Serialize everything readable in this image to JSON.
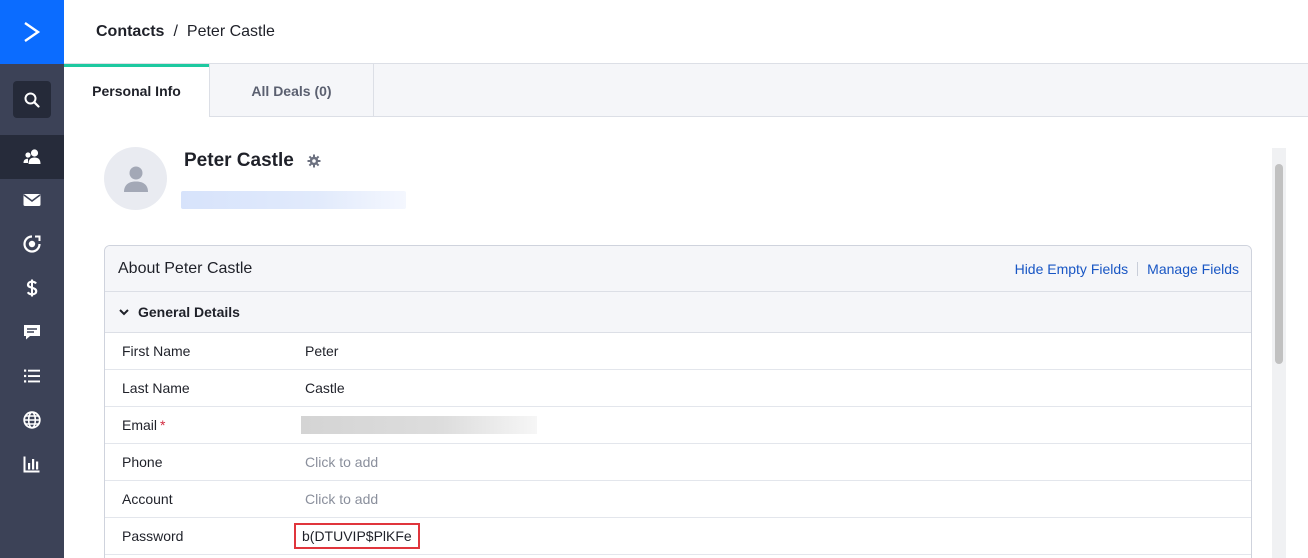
{
  "breadcrumb": {
    "root": "Contacts",
    "separator": "/",
    "current": "Peter Castle"
  },
  "tabs": [
    {
      "label": "Personal Info",
      "active": true
    },
    {
      "label": "All Deals (0)",
      "active": false
    }
  ],
  "sidebar": {
    "icons": [
      "logo-chevron-icon",
      "search-icon",
      "contacts-icon",
      "email-icon",
      "automation-icon",
      "deals-dollar-icon",
      "conversations-icon",
      "lists-icon",
      "website-globe-icon",
      "reports-chart-icon"
    ],
    "active": "contacts-icon"
  },
  "contact": {
    "name": "Peter Castle"
  },
  "about": {
    "title": "About Peter Castle",
    "hide_empty": "Hide Empty Fields",
    "manage_fields": "Manage Fields"
  },
  "section": {
    "title": "General Details"
  },
  "fields": {
    "first_name": {
      "label": "First Name",
      "value": "Peter"
    },
    "last_name": {
      "label": "Last Name",
      "value": "Castle"
    },
    "email": {
      "label": "Email",
      "required_mark": "*"
    },
    "phone": {
      "label": "Phone",
      "placeholder": "Click to add"
    },
    "account": {
      "label": "Account",
      "placeholder": "Click to add"
    },
    "password": {
      "label": "Password",
      "value": "b(DTUVIP$PlKFe"
    }
  },
  "colors": {
    "brand": "#0b6cff",
    "rail": "#3c4257",
    "tab_accent": "#1ec9a0",
    "link": "#1856c4",
    "highlight": "#e0353c"
  }
}
